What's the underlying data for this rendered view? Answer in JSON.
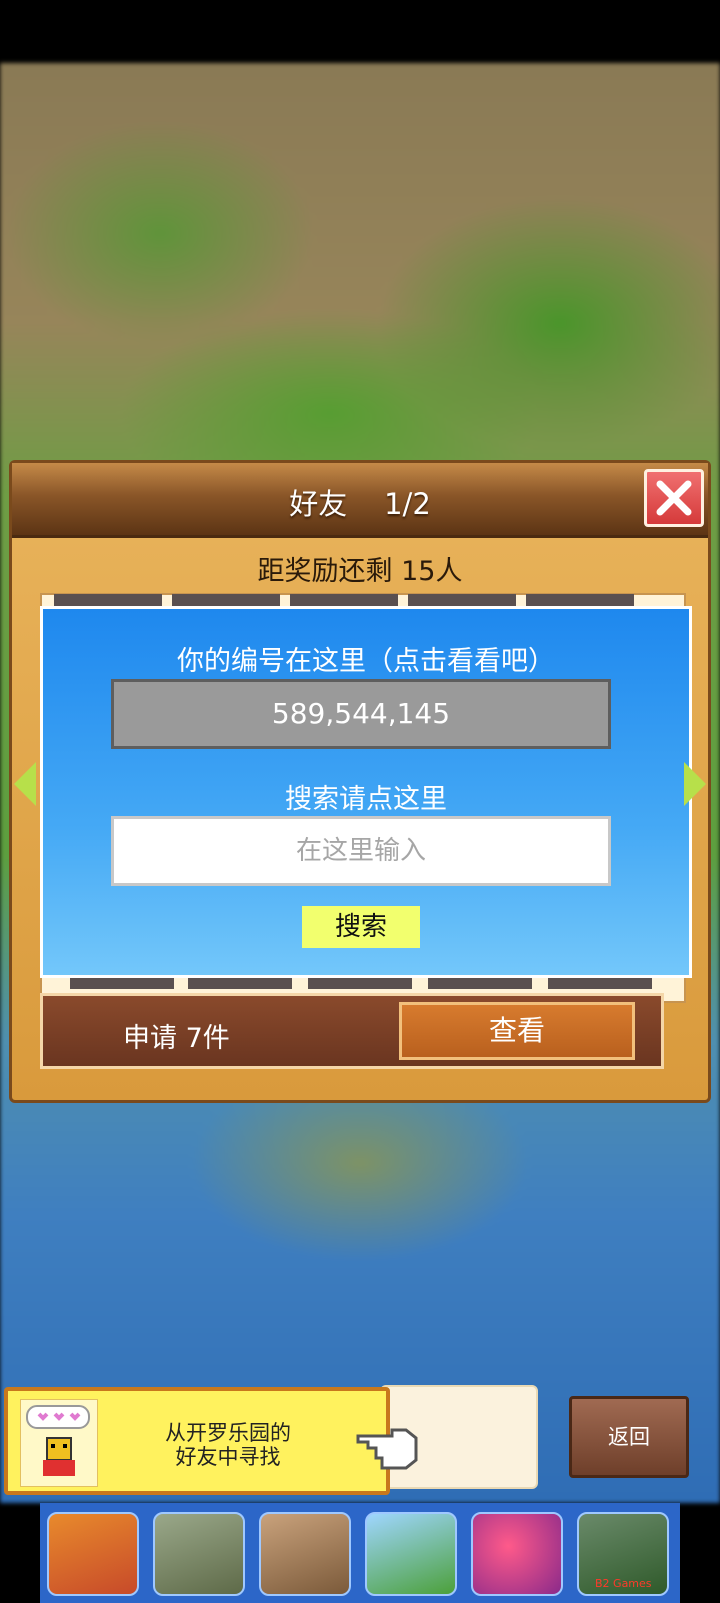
{
  "dialog": {
    "title": "好友    1/2",
    "reward": "距奖励还剩 15人",
    "id_prompt": "你的编号在这里（点击看看吧）",
    "player_id": "589,544,145",
    "search_prompt": "搜索请点这里",
    "search_placeholder": "在这里输入",
    "search_button": "搜索",
    "requests": "申请 7件",
    "view_button": "查看"
  },
  "banner": {
    "line1": "从开罗乐园的",
    "line2": "好友中寻找"
  },
  "footer": {
    "back_button": "返回"
  },
  "ads": {
    "icons": [
      "subway-runner-ad-icon",
      "tank-game-ad-icon",
      "soldier-game-ad-icon",
      "platformer-ad-icon",
      "candy-game-ad-icon",
      "soccer-game-ad-icon"
    ],
    "last_label": "B2 Games"
  },
  "colors": {
    "accent_blue": "#1e88ee",
    "close_red": "#e04848",
    "button_yellow": "#f2ff6e"
  }
}
